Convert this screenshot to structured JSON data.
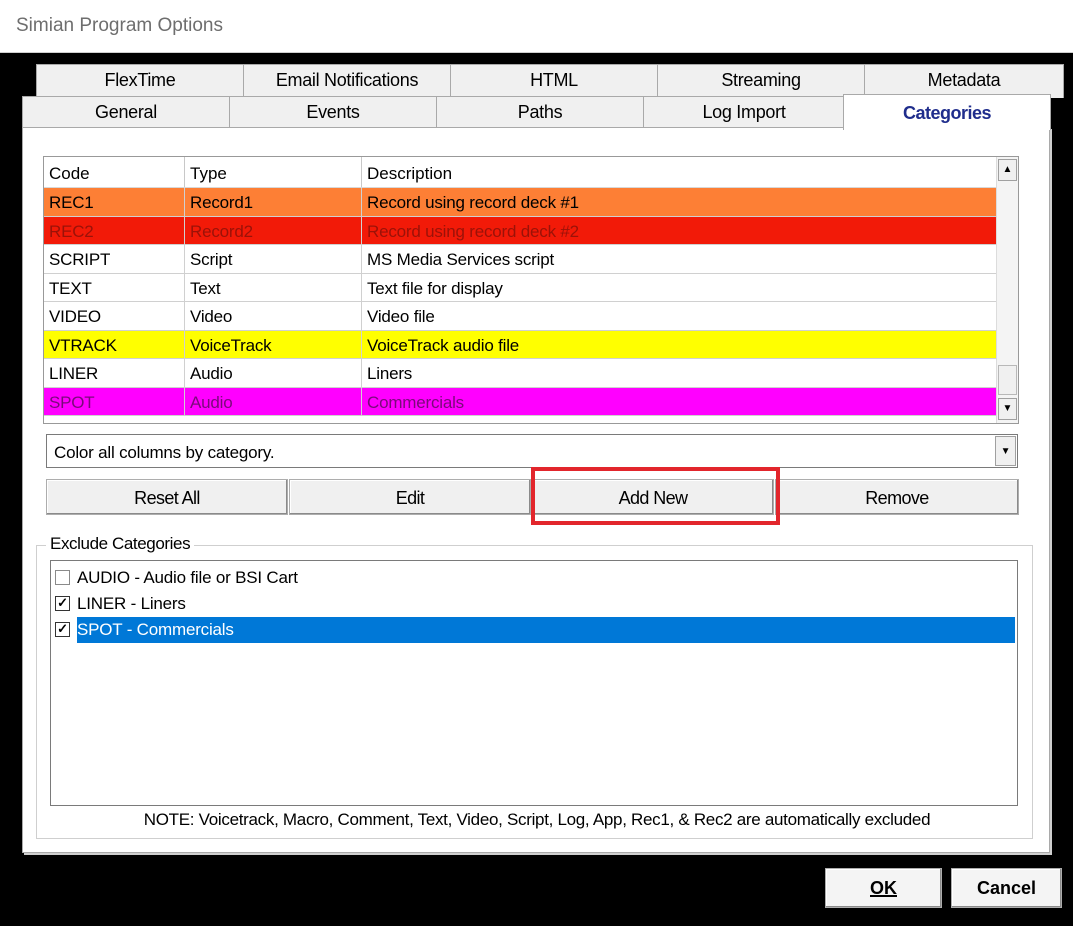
{
  "window": {
    "title": "Simian Program Options"
  },
  "tabs_back": [
    "FlexTime",
    "Email Notifications",
    "HTML",
    "Streaming",
    "Metadata"
  ],
  "tabs_front": [
    "General",
    "Events",
    "Paths",
    "Log Import",
    "Categories"
  ],
  "active_tab": "Categories",
  "grid": {
    "headers": [
      "Code",
      "Type",
      "Description"
    ],
    "rows": [
      {
        "code": "REC1",
        "type": "Record1",
        "description": "Record using record deck #1",
        "bg": "#fd7f35",
        "fg": "#000000"
      },
      {
        "code": "REC2",
        "type": "Record2",
        "description": "Record using record deck #2",
        "bg": "#f21a08",
        "fg": "#9b1208"
      },
      {
        "code": "SCRIPT",
        "type": "Script",
        "description": "MS Media Services script",
        "bg": "#ffffff",
        "fg": "#000000"
      },
      {
        "code": "TEXT",
        "type": "Text",
        "description": "Text file for display",
        "bg": "#ffffff",
        "fg": "#000000"
      },
      {
        "code": "VIDEO",
        "type": "Video",
        "description": "Video file",
        "bg": "#ffffff",
        "fg": "#000000"
      },
      {
        "code": "VTRACK",
        "type": "VoiceTrack",
        "description": "VoiceTrack audio file",
        "bg": "#ffff00",
        "fg": "#000000"
      },
      {
        "code": "LINER",
        "type": "Audio",
        "description": "Liners",
        "bg": "#ffffff",
        "fg": "#000000"
      },
      {
        "code": "SPOT",
        "type": "Audio",
        "description": "Commercials",
        "bg": "#ff00ff",
        "fg": "#7a0a7a"
      }
    ]
  },
  "color_mode": {
    "selected": "Color all columns by category."
  },
  "buttons": {
    "reset_all": "Reset All",
    "edit": "Edit",
    "add_new": "Add New",
    "remove": "Remove"
  },
  "exclude": {
    "label": "Exclude Categories",
    "items": [
      {
        "text": "AUDIO  -  Audio file or BSI Cart",
        "checked": false,
        "selected": false
      },
      {
        "text": "LINER  -  Liners",
        "checked": true,
        "selected": false
      },
      {
        "text": "SPOT  -  Commercials",
        "checked": true,
        "selected": true
      }
    ]
  },
  "note": "NOTE: Voicetrack, Macro, Comment, Text, Video, Script, Log, App, Rec1, & Rec2 are automatically excluded",
  "dialog_buttons": {
    "ok": "OK",
    "cancel": "Cancel"
  },
  "colors": {
    "selection": "#0078d7",
    "active_tab_text": "#1f2d8c",
    "highlight_box": "#e2262c"
  }
}
